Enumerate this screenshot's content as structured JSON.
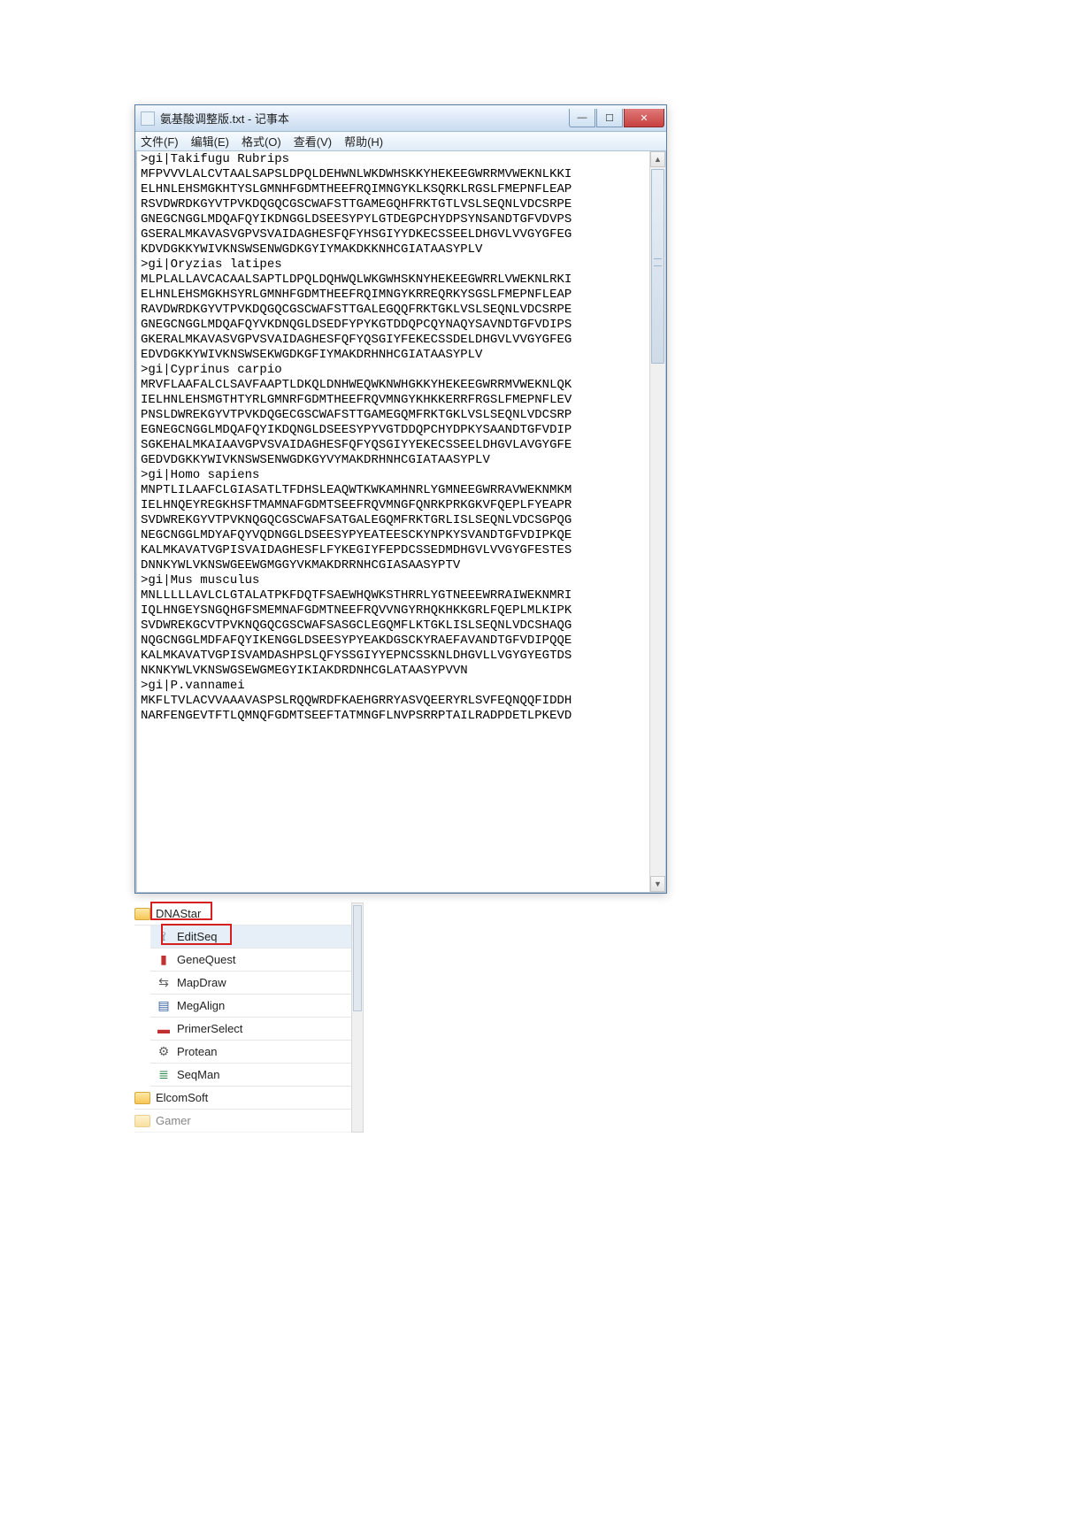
{
  "window": {
    "title": "氨基酸调整版.txt - 记事本",
    "controls": {
      "minimize": "—",
      "maximize": "☐",
      "close": "✕"
    }
  },
  "menu": {
    "file": "文件(F)",
    "edit": "编辑(E)",
    "format": "格式(O)",
    "view": "查看(V)",
    "help": "帮助(H)"
  },
  "text_lines": [
    ">gi|Takifugu Rubrips",
    "MFPVVVLALCVTAALSAPSLDPQLDEHWNLWKDWHSKKYHEKEEGWRRMVWEKNLKKI",
    "ELHNLEHSMGKHTYSLGMNHFGDMTHEEFRQIMNGYKLKSQRKLRGSLFMEPNFLEAP",
    "RSVDWRDKGYVTPVKDQGQCGSCWAFSTTGAMEGQHFRKTGTLVSLSEQNLVDCSRPE",
    "GNEGCNGGLMDQAFQYIKDNGGLDSEESYPYLGTDEGPCHYDPSYNSANDTGFVDVPS",
    "GSERALMKAVASVGPVSVAIDAGHESFQFYHSGIYYDKECSSEELDHGVLVVGYGFEG",
    "KDVDGKKYWIVKNSWSENWGDKGYIYMAKDKKNHCGIATAASYPLV",
    ">gi|Oryzias latipes",
    "MLPLALLAVCACAALSAPTLDPQLDQHWQLWKGWHSKNYHEKEEGWRRLVWEKNLRKI",
    "ELHNLEHSMGKHSYRLGMNHFGDMTHEEFRQIMNGYKRREQRKYSGSLFMEPNFLEAP",
    "RAVDWRDKGYVTPVKDQGQCGSCWAFSTTGALEGQQFRKTGKLVSLSEQNLVDCSRPE",
    "GNEGCNGGLMDQAFQYVKDNQGLDSEDFYPYKGTDDQPCQYNAQYSAVNDTGFVDIPS",
    "GKERALMKAVASVGPVSVAIDAGHESFQFYQSGIYFEKECSSDELDHGVLVVGYGFEG",
    "EDVDGKKYWIVKNSWSEKWGDKGFIYMAKDRHNHCGIATAASYPLV",
    ">gi|Cyprinus carpio",
    "MRVFLAAFALCLSAVFAAPTLDKQLDNHWEQWKNWHGKKYHEKEEGWRRMVWEKNLQK",
    "IELHNLEHSMGTHTYRLGMNRFGDMTHEEFRQVMNGYKHKKERRFRGSLFMEPNFLEV",
    "PNSLDWREKGYVTPVKDQGECGSCWAFSTTGAMEGQMFRKTGKLVSLSEQNLVDCSRP",
    "EGNEGCNGGLMDQAFQYIKDQNGLDSEESYPYVGTDDQPCHYDPKYSAANDTGFVDIP",
    "SGKEHALMKAIAAVGPVSVAIDAGHESFQFYQSGIYYEKECSSEELDHGVLAVGYGFE",
    "GEDVDGKKYWIVKNSWSENWGDKGYVYMAKDRHNHCGIATAASYPLV",
    ">gi|Homo sapiens",
    "MNPTLILAAFCLGIASATLTFDHSLEAQWTKWKAMHNRLYGMNEEGWRRAVWEKNMKM",
    "IELHNQEYREGKHSFTMAMNAFGDMTSEEFRQVMNGFQNRKPRKGKVFQEPLFYEAPR",
    "SVDWREKGYVTPVKNQGQCGSCWAFSATGALEGQMFRKTGRLISLSEQNLVDCSGPQG",
    "NEGCNGGLMDYAFQYVQDNGGLDSEESYPYEATEESCKYNPKYSVANDTGFVDIPKQE",
    "KALMKAVATVGPISVAIDAGHESFLFYKEGIYFEPDCSSEDMDHGVLVVGYGFESTES",
    "DNNKYWLVKNSWGEEWGMGGYVKMAKDRRNHCGIASAASYPTV",
    ">gi|Mus musculus",
    "MNLLLLLAVLCLGTALATPKFDQTFSAEWHQWKSTHRRLYGTNEEEWRRAIWEKNMRI",
    "IQLHNGEYSNGQHGFSMEMNAFGDMTNEEFRQVVNGYRHQKHKKGRLFQEPLMLKIPK",
    "SVDWREKGCVTPVKNQGQCGSCWAFSASGCLEGQMFLKTGKLISLSEQNLVDCSHAQG",
    "NQGCNGGLMDFAFQYIKENGGLDSEESYPYEAKDGSCKYRAEFAVANDTGFVDIPQQE",
    "KALMKAVATVGPISVAMDASHPSLQFYSSGIYYEPNCSSKNLDHGVLLVGYGYEGTDS",
    "NKNKYWLVKNSWGSEWGMEGYIKIAKDRDNHCGLATAASYPVVN",
    ">gi|P.vannamei",
    "MKFLTVLACVVAAAVASPSLRQQWRDFKAEHGRRYASVQEERYRLSVFEQNQQFIDDH",
    "NARFENGEVTFTLQMNQFGDMTSEEFTATMNGFLNVPSRRPTAILRADPDETLPKEVD"
  ],
  "program_list": {
    "folder1": "DNAStar",
    "items": [
      {
        "label": "EditSeq",
        "icon": "globe-icon"
      },
      {
        "label": "GeneQuest",
        "icon": "red-square-icon"
      },
      {
        "label": "MapDraw",
        "icon": "arrows-icon"
      },
      {
        "label": "MegAlign",
        "icon": "blue-bars-icon"
      },
      {
        "label": "PrimerSelect",
        "icon": "red-dash-icon"
      },
      {
        "label": "Protean",
        "icon": "gear-icon"
      },
      {
        "label": "SeqMan",
        "icon": "seq-icon"
      }
    ],
    "folder2": "ElcomSoft",
    "folder3": "Gamer"
  }
}
